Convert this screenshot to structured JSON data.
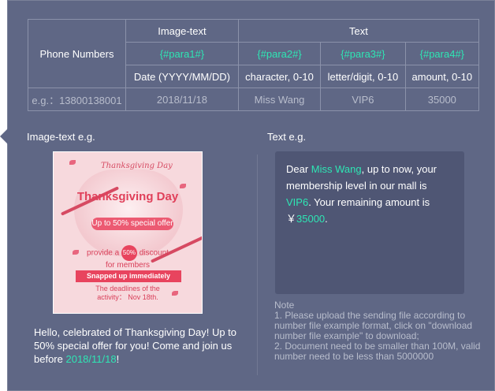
{
  "table": {
    "header": {
      "phone_numbers": "Phone Numbers",
      "image_text": "Image-text",
      "text": "Text"
    },
    "params": [
      "{#para1#}",
      "{#para2#}",
      "{#para3#}",
      "{#para4#}"
    ],
    "formats": [
      "Date (YYYY/MM/DD)",
      "character, 0-10",
      "letter/digit, 0-10",
      "amount, 0-10"
    ],
    "example": {
      "label": "e.g.：13800138001",
      "values": [
        "2018/11/18",
        "Miss Wang",
        "VIP6",
        "35000"
      ]
    }
  },
  "image_text_section": {
    "title": "Image-text e.g.",
    "promo": {
      "script_title": "Thanksgiving Day",
      "title": "Thanksgiving Day",
      "banner": "Up to 50% special offer",
      "discount_prefix": "provide a",
      "discount_badge": "50%",
      "discount_suffix": "discount",
      "discount_line2": "for members",
      "snap": "Snapped up immediately",
      "deadline_line1": "The deadlines of the",
      "deadline_line2": "activity： Nov 18th."
    },
    "caption": {
      "text": "Hello, celebrated of Thanksgiving Day! Up to 50% special offer for you! Come and join us before ",
      "date": "2018/11/18",
      "end": "!"
    }
  },
  "text_section": {
    "title": "Text e.g.",
    "message": {
      "p1": "Dear ",
      "name": "Miss Wang",
      "p2": ", up to now, your membership level in our mall is ",
      "level": "VIP6",
      "p3": ". Your remaining amount is ￥",
      "amount": "35000",
      "p4": "."
    }
  },
  "note": {
    "title": "Note",
    "line1": "1. Please upload the sending file according to number file example format, click on \"download number file example\" to download;",
    "line2": "2. Document need to be smaller than 100M, valid number need to be less than 5000000"
  },
  "colors": {
    "panel": "#5f6785",
    "highlight": "#2ee6b4",
    "textbox": "#4f5674"
  }
}
